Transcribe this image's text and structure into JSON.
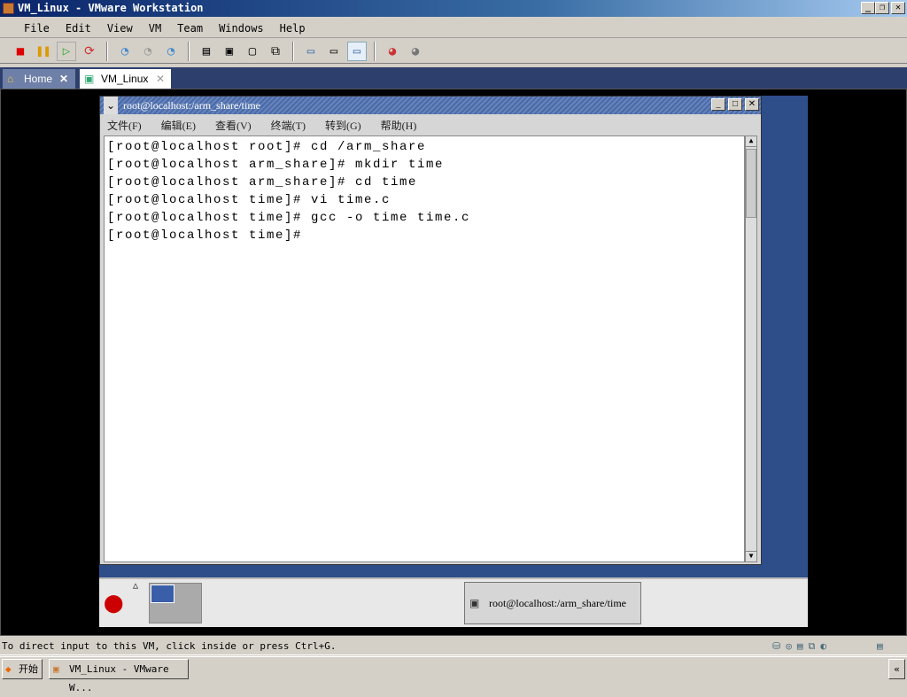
{
  "window": {
    "title": "VM_Linux - VMware Workstation"
  },
  "menu": [
    "File",
    "Edit",
    "View",
    "VM",
    "Team",
    "Windows",
    "Help"
  ],
  "tabs": [
    {
      "label": "Home"
    },
    {
      "label": "VM_Linux"
    }
  ],
  "terminal": {
    "title": "root@localhost:/arm_share/time",
    "menu": [
      "文件(F)",
      "编辑(E)",
      "查看(V)",
      "终端(T)",
      "转到(G)",
      "帮助(H)"
    ],
    "lines": [
      "[root@localhost root]# cd /arm_share",
      "[root@localhost arm_share]# mkdir time",
      "[root@localhost arm_share]# cd time",
      "[root@localhost time]# vi time.c",
      "[root@localhost time]# gcc -o time time.c",
      "[root@localhost time]#"
    ]
  },
  "panel": {
    "task": "root@localhost:/arm_share/time"
  },
  "status": "To direct input to this VM, click inside or press Ctrl+G.",
  "taskbar": {
    "start": "开始",
    "task": "VM_Linux - VMware W..."
  }
}
